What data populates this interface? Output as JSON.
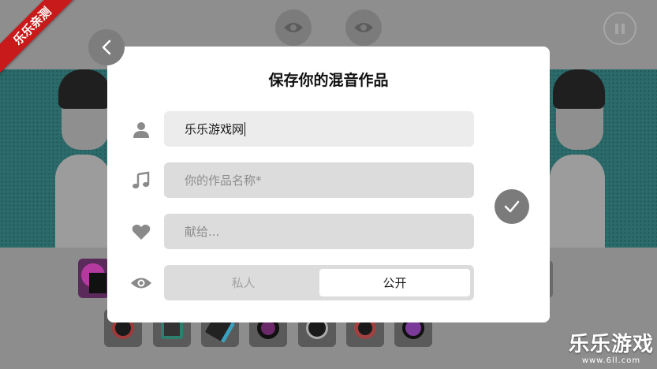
{
  "ribbon": {
    "label": "乐乐亲测"
  },
  "watermark": {
    "brand": "乐乐游戏",
    "url": "www.6ll.com"
  },
  "dialog": {
    "title": "保存你的混音作品",
    "fields": {
      "author": {
        "value": "乐乐游戏网",
        "icon": "user-icon"
      },
      "track_name": {
        "placeholder": "你的作品名称*",
        "icon": "music-note-icon"
      },
      "dedication": {
        "placeholder": "献给...",
        "icon": "heart-icon"
      }
    },
    "visibility": {
      "icon": "eye-icon",
      "options": [
        "私人",
        "公开"
      ],
      "selected": "公开"
    }
  },
  "colors": {
    "ribbon": "#c81a1a",
    "dialog_bg": "#ffffff",
    "field_bg": "#dcdcdc",
    "icon_gray": "#7d7d7d",
    "stage_teal": "#2c6b6b"
  }
}
